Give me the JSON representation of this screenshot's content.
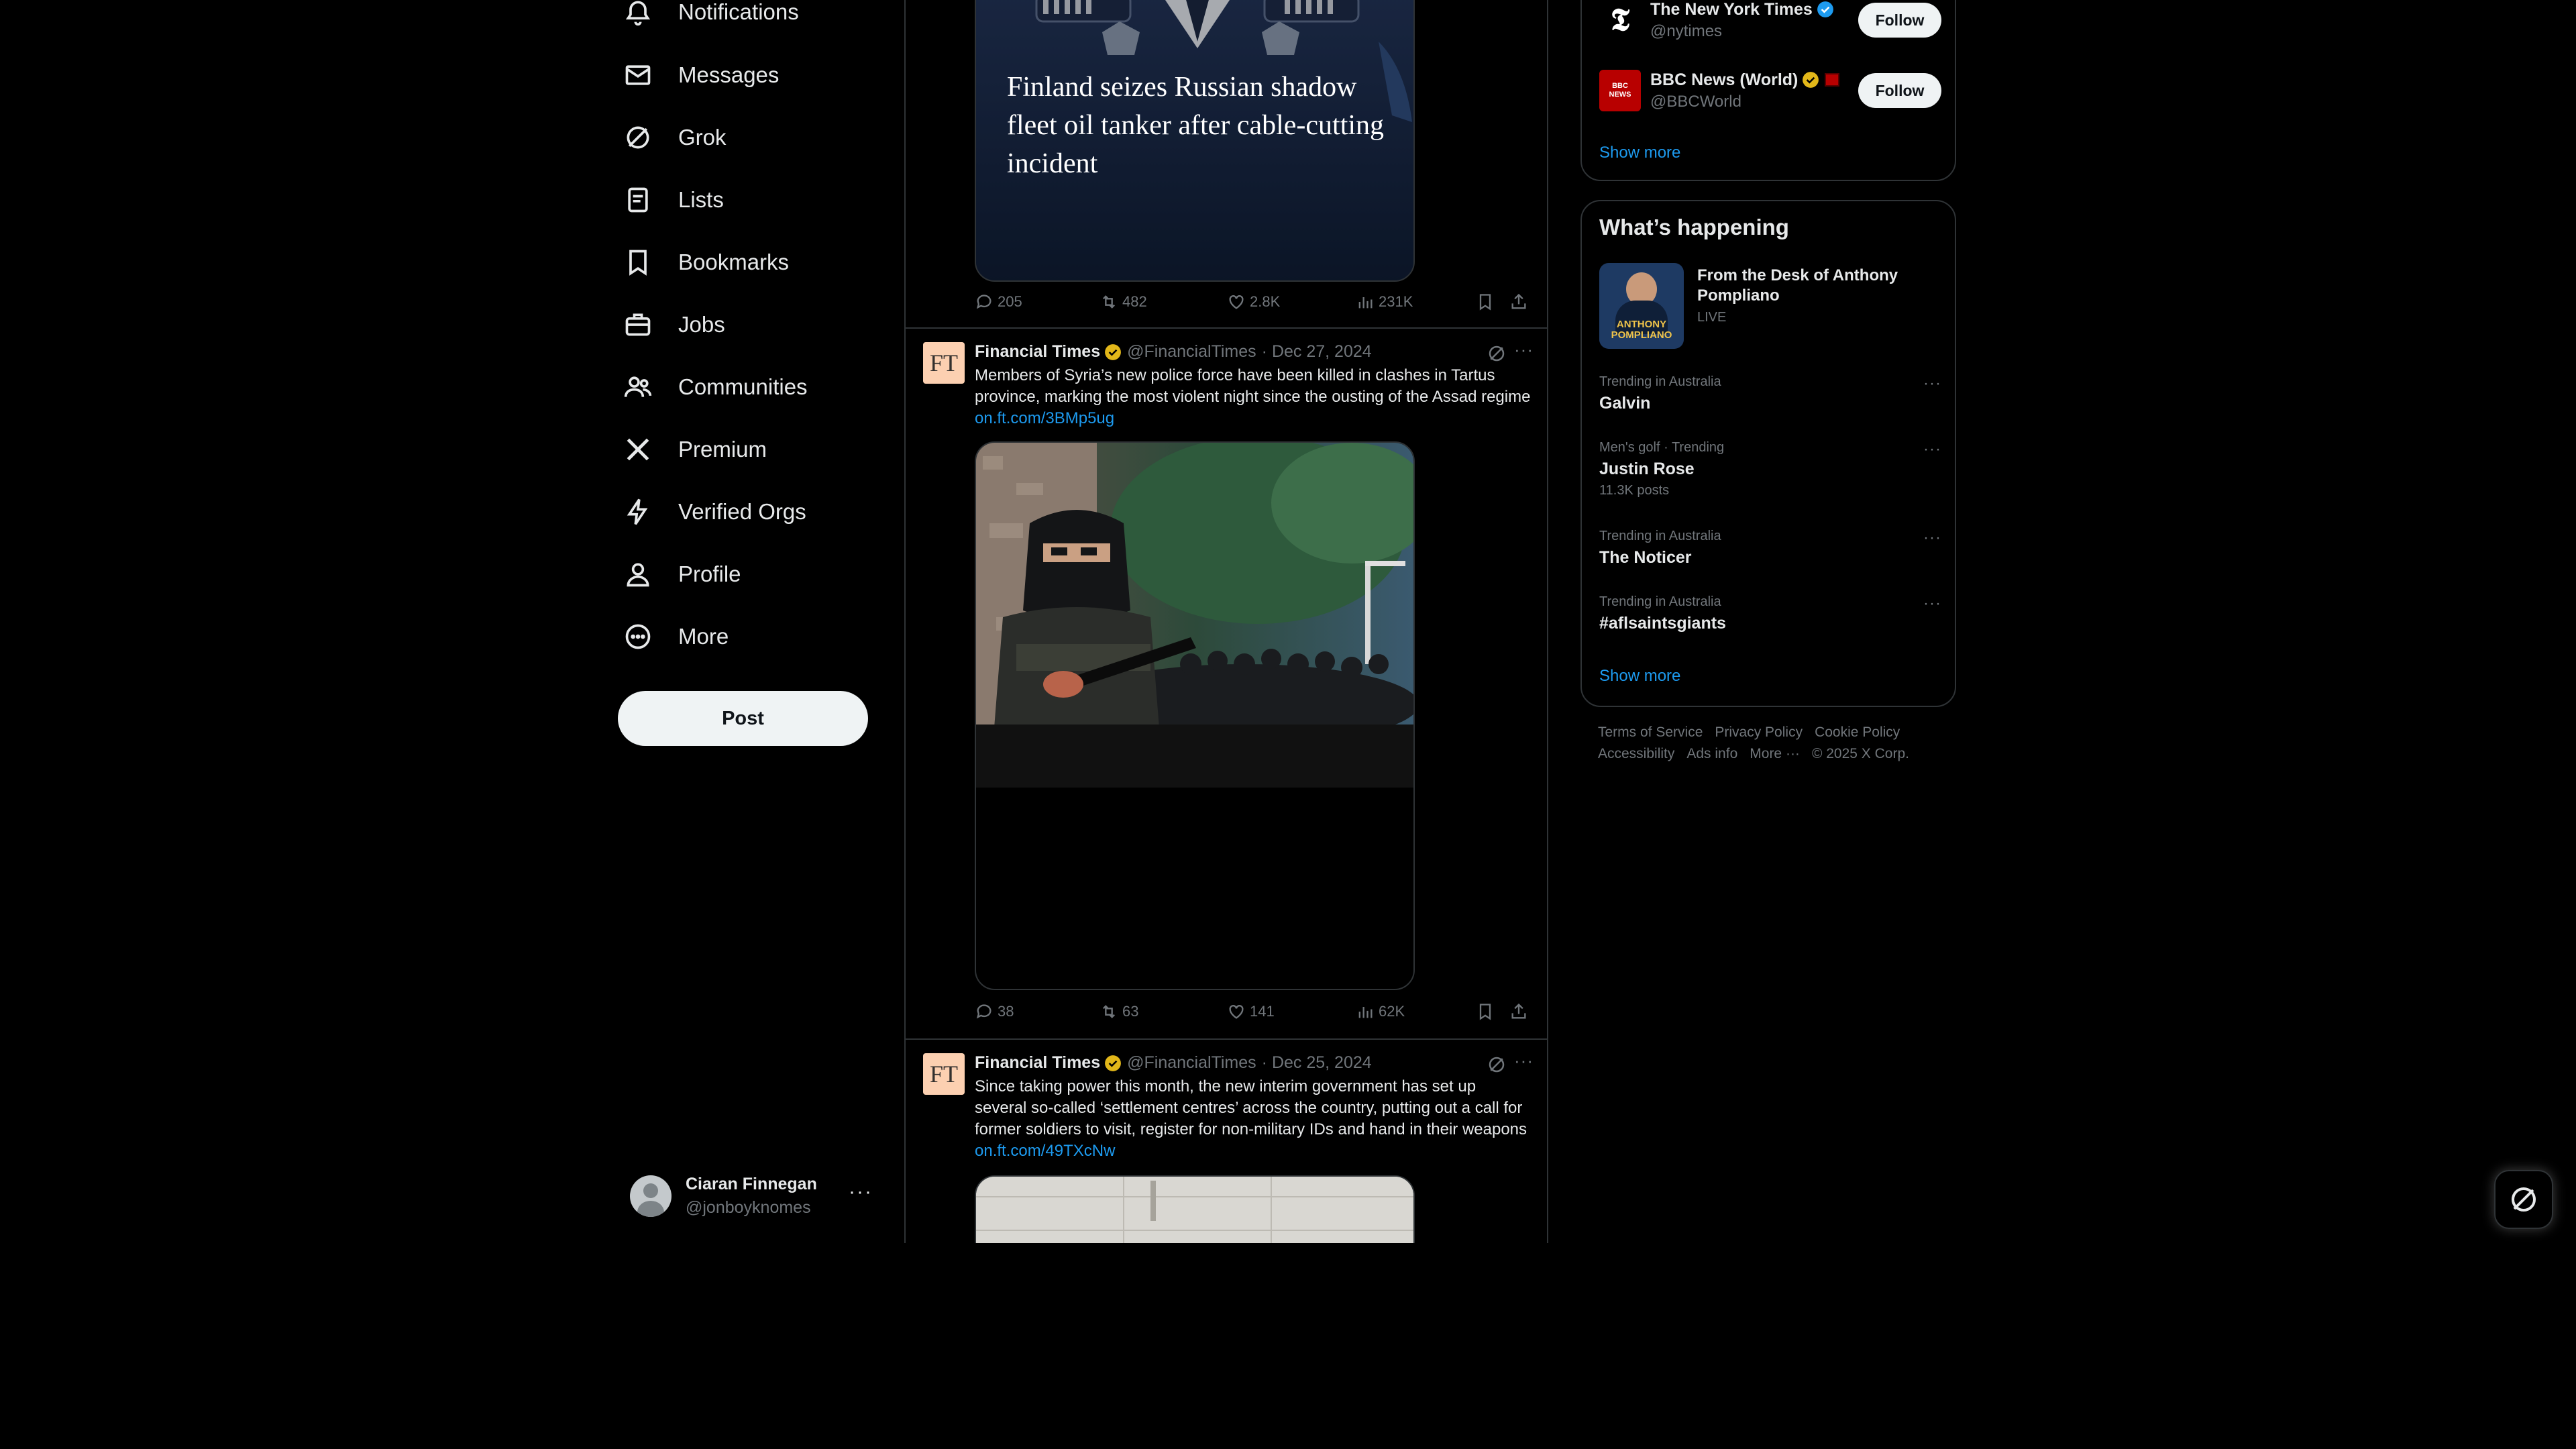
{
  "nav": {
    "items": [
      {
        "label": "Notifications",
        "icon": "bell-icon"
      },
      {
        "label": "Messages",
        "icon": "envelope-icon"
      },
      {
        "label": "Grok",
        "icon": "grok-icon"
      },
      {
        "label": "Lists",
        "icon": "list-icon"
      },
      {
        "label": "Bookmarks",
        "icon": "bookmark-icon"
      },
      {
        "label": "Jobs",
        "icon": "briefcase-icon"
      },
      {
        "label": "Communities",
        "icon": "people-icon"
      },
      {
        "label": "Premium",
        "icon": "x-logo-icon"
      },
      {
        "label": "Verified Orgs",
        "icon": "lightning-icon"
      },
      {
        "label": "Profile",
        "icon": "person-icon"
      },
      {
        "label": "More",
        "icon": "more-circle-icon"
      }
    ],
    "post_label": "Post"
  },
  "account": {
    "name": "Ciaran Finnegan",
    "handle": "@jonboyknomes",
    "more": "···"
  },
  "feed": {
    "tweet0": {
      "headline": "Finland seizes Russian shadow fleet oil tanker after cable-cutting incident",
      "stats": {
        "replies": "205",
        "reposts": "482",
        "likes": "2.8K",
        "views": "231K"
      }
    },
    "tweet1": {
      "name": "Financial Times",
      "handle": "@FinancialTimes",
      "date": "· Dec 27, 2024",
      "avatar_text": "FT",
      "text": "Members of Syria’s new police force have been killed in clashes in Tartus province, marking the most violent night since the ousting of the Assad regime ",
      "link": "on.ft.com/3BMp5ug",
      "stats": {
        "replies": "38",
        "reposts": "63",
        "likes": "141",
        "views": "62K"
      }
    },
    "tweet2": {
      "name": "Financial Times",
      "handle": "@FinancialTimes",
      "date": "· Dec 25, 2024",
      "avatar_text": "FT",
      "text": "Since taking power this month, the new interim government has set up several so-called ‘settlement centres’ across the country, putting out a call for former soldiers to visit, register for non-military IDs and hand in their weapons ",
      "link": "on.ft.com/49TXcNw"
    }
  },
  "who_to_follow": {
    "accounts": [
      {
        "name": "The New York Times",
        "handle": "@nytimes",
        "follow_label": "Follow",
        "logo_text": "𝕿"
      },
      {
        "name": "BBC News (World)",
        "handle": "@BBCWorld",
        "follow_label": "Follow",
        "logo_text": "BBC NEWS"
      }
    ],
    "show_more": "Show more"
  },
  "whats_happening": {
    "title": "What’s happening",
    "featured": {
      "title": "From the Desk of Anthony Pompliano",
      "status": "LIVE",
      "thumb_text": "ANTHONY POMPLIANO"
    },
    "trends": [
      {
        "context": "Trending in Australia",
        "topic": "Galvin",
        "count": ""
      },
      {
        "context": "Men's golf · Trending",
        "topic": "Justin Rose",
        "count": "11.3K posts"
      },
      {
        "context": "Trending in Australia",
        "topic": "The Noticer",
        "count": ""
      },
      {
        "context": "Trending in Australia",
        "topic": "#aflsaintsgiants",
        "count": ""
      }
    ],
    "show_more": "Show more"
  },
  "footer": {
    "links": [
      "Terms of Service",
      "Privacy Policy",
      "Cookie Policy",
      "Accessibility",
      "Ads info",
      "More ···",
      "© 2025 X Corp."
    ]
  },
  "colors": {
    "accent": "#1d9bf0",
    "verified_gold": "#e2b719",
    "background": "#000000",
    "border": "#2f3336",
    "muted": "#71767b"
  }
}
